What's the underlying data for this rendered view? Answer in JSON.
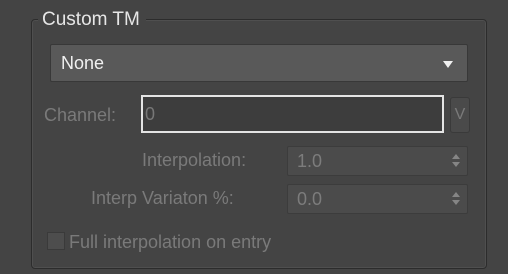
{
  "group": {
    "title": "Custom TM"
  },
  "dropdown": {
    "selected": "None"
  },
  "channel": {
    "label": "Channel:",
    "value": "0",
    "button_label": "V"
  },
  "interpolation": {
    "label": "Interpolation:",
    "value": "1.0"
  },
  "variation": {
    "label": "Interp Variaton %:",
    "value": "0.0"
  },
  "full_interpolation": {
    "label": "Full interpolation on entry",
    "checked": false
  }
}
